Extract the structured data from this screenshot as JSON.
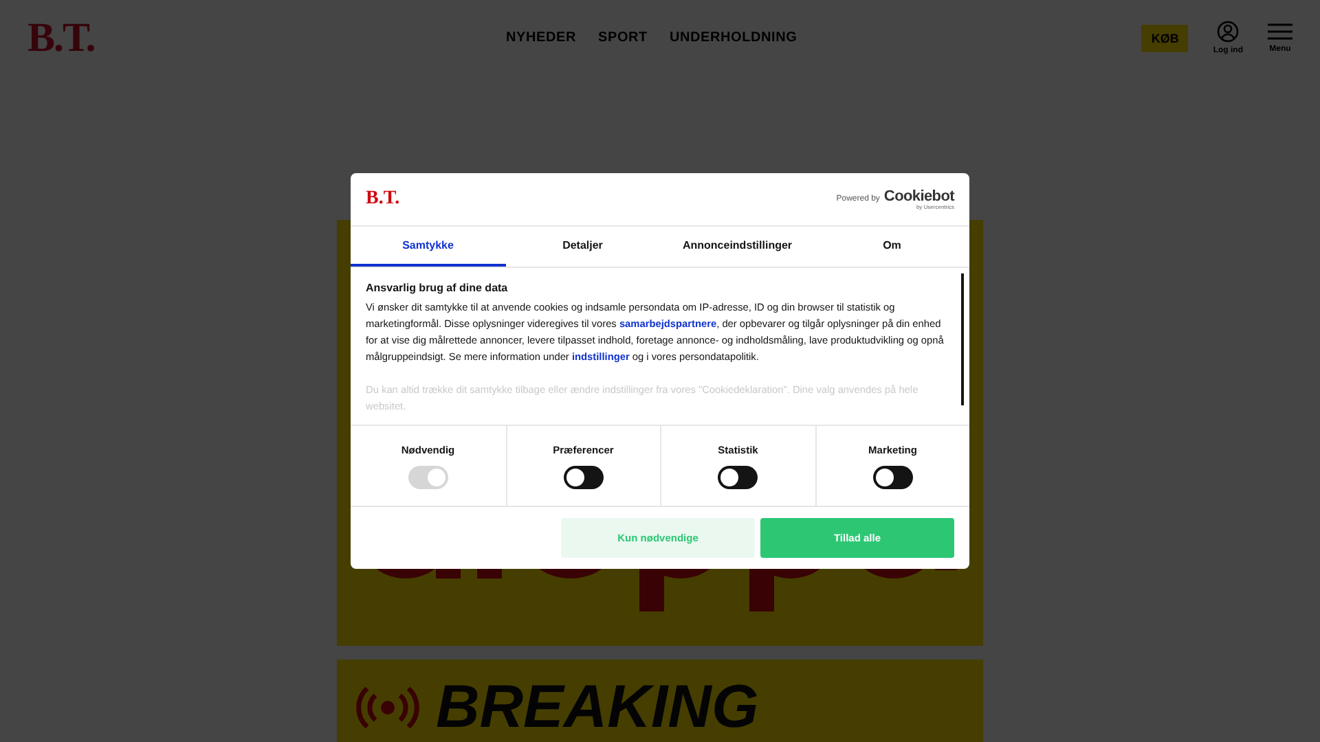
{
  "header": {
    "logo": "B.T.",
    "nav": [
      "NYHEDER",
      "SPORT",
      "UNDERHOLDNING"
    ],
    "buy": "KØB",
    "login": "Log ind",
    "menu": "Menu"
  },
  "breaking": {
    "label": "BREAKING"
  },
  "dialog": {
    "logo": "B.T.",
    "powered_by": "Powered by",
    "brand": "Cookiebot",
    "brand_sub": "by Usercentrics",
    "tabs": [
      {
        "label": "Samtykke",
        "selected": true
      },
      {
        "label": "Detaljer",
        "selected": false
      },
      {
        "label": "Annonceindstillinger",
        "selected": false
      },
      {
        "label": "Om",
        "selected": false
      }
    ],
    "heading": "Ansvarlig brug af dine data",
    "paragraph": [
      {
        "kind": "text",
        "text": "Vi ønsker dit samtykke til at anvende cookies og indsamle persondata om IP-adresse, ID og din browser til statistik og marketingformål. Disse oplysninger videregives til vores "
      },
      {
        "kind": "link",
        "text": "samarbejdspartnere"
      },
      {
        "kind": "text",
        "text": ", der opbevarer og tilgår oplysninger på din enhed for at vise dig målrettede annoncer, levere tilpasset indhold, foretage annonce- og indholdsmåling, lave produktudvikling og opnå målgruppeindsigt. Se mere information under "
      },
      {
        "kind": "link",
        "text": "indstillinger"
      },
      {
        "kind": "text",
        "text": " og i vores persondatapolitik."
      }
    ],
    "faded_paragraph": "Du kan altid trække dit samtykke tilbage eller ændre indstillinger fra vores \"Cookiedeklaration\". Dine valg anvendes på hele websitet.",
    "toggles": [
      {
        "label": "Nødvendig",
        "on": true,
        "disabled": true
      },
      {
        "label": "Præferencer",
        "on": false,
        "disabled": false
      },
      {
        "label": "Statistik",
        "on": false,
        "disabled": false
      },
      {
        "label": "Marketing",
        "on": false,
        "disabled": false
      }
    ],
    "buttons": [
      {
        "label": "Kun nødvendige",
        "kind": "secondary"
      },
      {
        "label": "Tillad alle",
        "kind": "primary"
      }
    ]
  }
}
